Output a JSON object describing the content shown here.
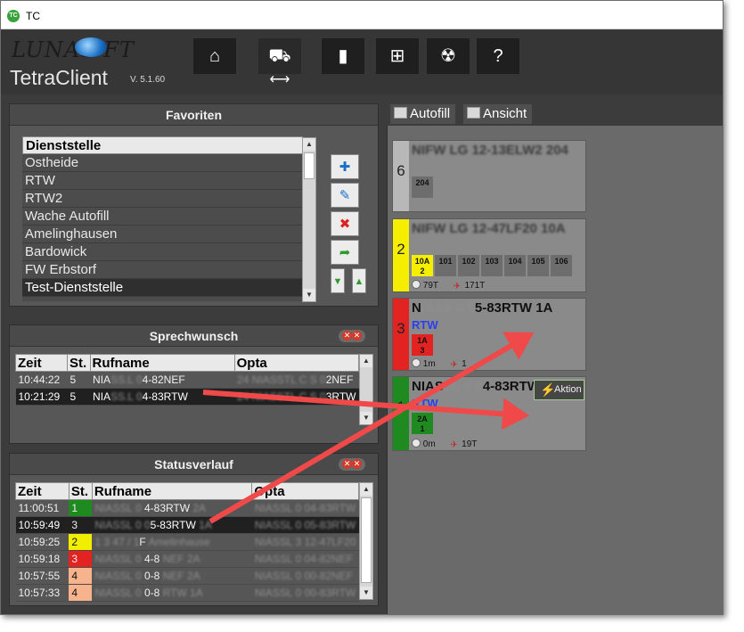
{
  "window": {
    "title": "TC",
    "icon_label": "TC",
    "app_name": "TetraClient",
    "version": "V. 5.1.60",
    "logo_text": "LUNAS  FT"
  },
  "toolbar": {
    "home": "⌂",
    "vehicles": "⛟",
    "radio": "▮",
    "tree": "⊞",
    "nuclear": "☢",
    "help": "?",
    "vehicles_arrow": "⟷"
  },
  "favoriten": {
    "title": "Favoriten",
    "items": [
      "Dienststelle",
      "Ostheide",
      "RTW",
      "RTW2",
      "Wache Autofill",
      "Amelinghausen",
      "Bardowick",
      "FW Erbstorf",
      "Test-Dienststelle"
    ]
  },
  "sprechwunsch": {
    "title": "Sprechwunsch",
    "close_label": "✕✕",
    "headers": [
      "Zeit",
      "St.",
      "Rufname",
      "Opta"
    ],
    "rows": [
      {
        "zeit": "10:44:22",
        "st": "5",
        "ruf_pre": "NIA",
        "ruf_blur": "SS.L 0",
        "ruf_post": "4-82NEF",
        "opta_blur": "24  NIASSTL C  S 0",
        "opta_post": "2NEF"
      },
      {
        "zeit": "10:21:29",
        "st": "5",
        "ruf_pre": "NIA",
        "ruf_blur": "SS.L 0",
        "ruf_post": "4-83RTW",
        "opta_blur": "24  NIASSTL C  S 0",
        "opta_post": "3RTW"
      }
    ]
  },
  "statusverlauf": {
    "title": "Statusverlauf",
    "close_label": "✕✕",
    "headers": [
      "Zeit",
      "St.",
      "Rufname",
      "Opta"
    ],
    "rows": [
      {
        "zeit": "11:00:51",
        "st": "1",
        "color": "#1f8a1f",
        "ruf_blur": "NIASSL 0 ",
        "ruf_post": "4-83RTW",
        "extra": "2A",
        "opta_blur": "NIASSL 0 04-83RTW"
      },
      {
        "zeit": "10:59:49",
        "st": "3",
        "color": "#202020",
        "ruf_blur": "NIASSL 0 0",
        "ruf_post": "5-83RTW",
        "extra": "1A",
        "opta_blur": "NIASSL 0 05-83RTW"
      },
      {
        "zeit": "10:59:25",
        "st": "2",
        "color": "#f2ee00",
        "ruf_blur": "1 3 47 / 1",
        "ruf_post": "F",
        "extra": "Amelinhause",
        "opta_blur": "NIASSL 3 12-47LF20"
      },
      {
        "zeit": "10:59:18",
        "st": "3",
        "color": "#e32222",
        "ruf_blur": "NIASSL 0 ",
        "ruf_post": "4-8",
        "extra": "NEF  2A",
        "opta_blur": "NIASSL 0 04-82NEF"
      },
      {
        "zeit": "10:57:55",
        "st": "4",
        "color": "#f6b38c",
        "ruf_blur": "NIASSL 0 ",
        "ruf_post": "0-8",
        "extra": "NEF  2A",
        "opta_blur": "NIASSL 0 00-82NEF"
      },
      {
        "zeit": "10:57:33",
        "st": "4",
        "color": "#f6b38c",
        "ruf_blur": "NIASSL 0 ",
        "ruf_post": "0-8",
        "extra": "RTW  1A",
        "opta_blur": "NIASSL 0 00-83RTW"
      }
    ]
  },
  "right_tabs": {
    "autofill": "Autofill",
    "ansicht": "Ansicht"
  },
  "cards": [
    {
      "status": "6",
      "color": "#b8b8b8",
      "title": "NIFW LG 12-13ELW2   204",
      "sub": "",
      "chips": [
        {
          "label": "204",
          "sub": "",
          "color": "#6d6d6d"
        }
      ],
      "time": "",
      "signal": ""
    },
    {
      "status": "2",
      "color": "#f6ee00",
      "title": "NIFW LG 12-47LF20   10A",
      "sub": "",
      "chips": [
        {
          "label": "10A",
          "sub": "2",
          "color": "#f6ee00"
        },
        {
          "label": "101",
          "sub": "",
          "color": "#6d6d6d"
        },
        {
          "label": "102",
          "sub": "",
          "color": "#6d6d6d"
        },
        {
          "label": "103",
          "sub": "",
          "color": "#6d6d6d"
        },
        {
          "label": "104",
          "sub": "",
          "color": "#6d6d6d"
        },
        {
          "label": "105",
          "sub": "",
          "color": "#6d6d6d"
        },
        {
          "label": "106",
          "sub": "",
          "color": "#6d6d6d"
        }
      ],
      "time": "79T",
      "signal": "171T"
    },
    {
      "status": "3",
      "color": "#e32222",
      "title_pre": "N",
      "title_blur": "IASS 0 0",
      "title_post": "5-83RTW       1A",
      "sub": "RTW",
      "chips": [
        {
          "label": "1A",
          "sub": "3",
          "color": "#e32222"
        }
      ],
      "time": "1m",
      "signal": "1"
    },
    {
      "status": "1",
      "color": "#1f8a1f",
      "title_pre": "NIAS",
      "title_blur": "SL 0 0",
      "title_post": "4-83RTW",
      "sub": "RTW",
      "chips": [
        {
          "label": "2A",
          "sub": "1",
          "color": "#1f8a1f"
        }
      ],
      "time": "0m",
      "signal": "19T"
    }
  ],
  "aktion_label": "Aktion",
  "annotation_color": "#ef4949"
}
